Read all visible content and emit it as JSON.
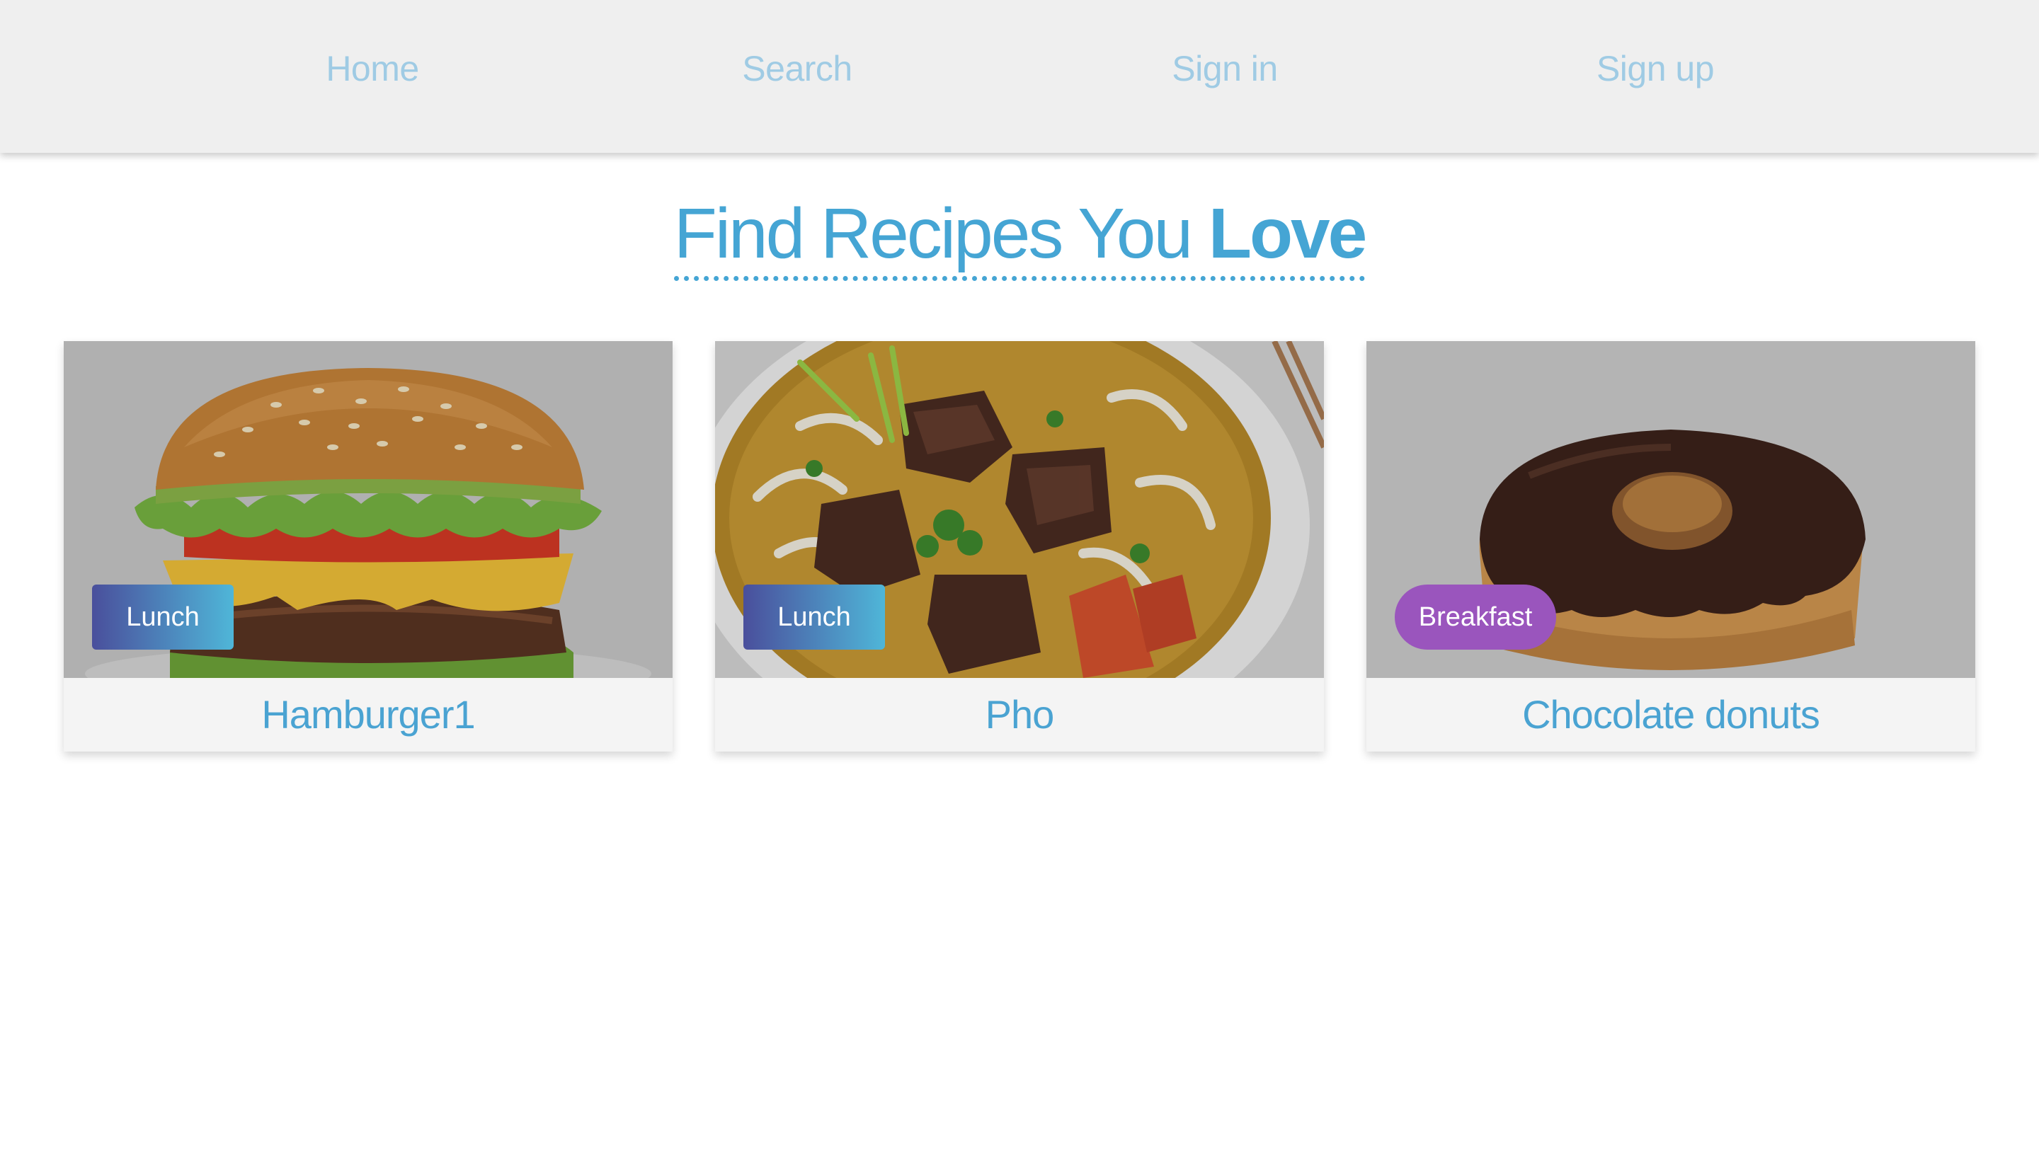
{
  "nav": {
    "home": "Home",
    "search": "Search",
    "signin": "Sign in",
    "signup": "Sign up"
  },
  "heading": {
    "light": "Find Recipes You",
    "bold": "Love"
  },
  "cards": [
    {
      "title": "Hamburger1",
      "tag": "Lunch",
      "image_icon": "hamburger-photo"
    },
    {
      "title": "Pho",
      "tag": "Lunch",
      "image_icon": "pho-bowl-photo"
    },
    {
      "title": "Chocolate donuts",
      "tag": "Breakfast",
      "image_icon": "chocolate-donut-photo"
    }
  ],
  "colors": {
    "accent": "#45a5d4",
    "nav_link": "#9fcbe4",
    "nav_bg": "#efefef",
    "tag_lunch_start": "#4a4f9c",
    "tag_lunch_end": "#4fb6d8",
    "tag_breakfast": "#9a55bd"
  }
}
